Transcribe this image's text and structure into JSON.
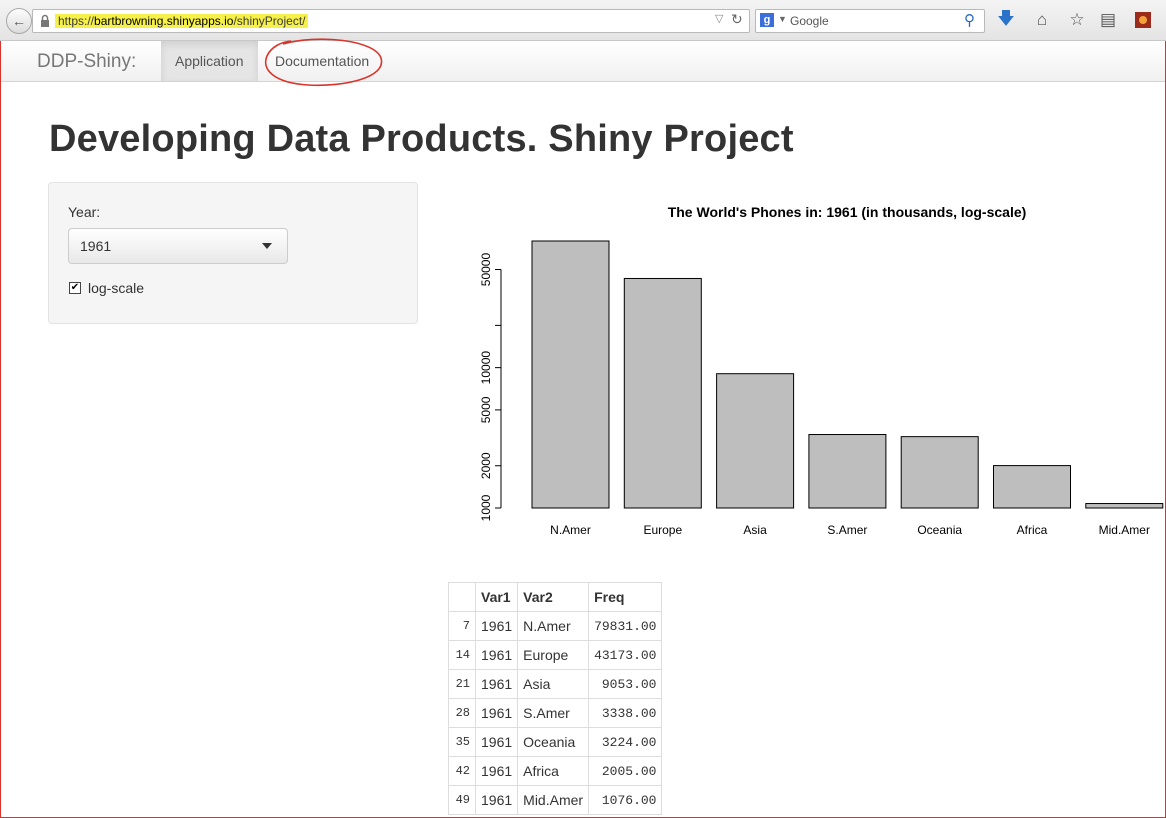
{
  "browser": {
    "url": "https://bartbrowning.shinyapps.io/shinyProject/",
    "url_prefix": "https://",
    "url_host": "bartbrowning.shinyapps.io",
    "url_path": "/shinyProject/",
    "search_placeholder": "Google",
    "icons": [
      "back-arrow-icon",
      "lock-icon",
      "reload-icon",
      "google-icon",
      "search-icon",
      "download-icon",
      "home-icon",
      "bookmark-star-icon",
      "reading-list-icon",
      "addon-icon"
    ]
  },
  "navbar": {
    "brand": "DDP-Shiny:",
    "tabs": [
      {
        "label": "Application",
        "active": true
      },
      {
        "label": "Documentation",
        "active": false
      }
    ]
  },
  "page": {
    "title": "Developing Data Products. Shiny Project"
  },
  "sidebar": {
    "year_label": "Year:",
    "year_value": "1961",
    "log_checkbox_label": "log-scale",
    "log_checked": true
  },
  "chart_data": {
    "type": "bar",
    "title": "The World's Phones in: 1961 (in thousands, log-scale)",
    "categories": [
      "N.Amer",
      "Europe",
      "Asia",
      "S.Amer",
      "Oceania",
      "Africa",
      "Mid.Amer"
    ],
    "values": [
      79831,
      43173,
      9053,
      3338,
      3224,
      2005,
      1076
    ],
    "y_scale": "log",
    "y_ticks": [
      1000,
      2000,
      5000,
      10000,
      20000,
      50000
    ],
    "y_tick_labels": [
      "1000",
      "2000",
      "5000",
      "10000",
      "",
      "50000"
    ],
    "ylim": [
      1000,
      79831
    ],
    "bar_color": "#bebebe",
    "xlabel": "",
    "ylabel": ""
  },
  "table": {
    "columns": [
      "",
      "Var1",
      "Var2",
      "Freq"
    ],
    "rows": [
      [
        "7",
        "1961",
        "N.Amer",
        "79831.00"
      ],
      [
        "14",
        "1961",
        "Europe",
        "43173.00"
      ],
      [
        "21",
        "1961",
        "Asia",
        "9053.00"
      ],
      [
        "28",
        "1961",
        "S.Amer",
        "3338.00"
      ],
      [
        "35",
        "1961",
        "Oceania",
        "3224.00"
      ],
      [
        "42",
        "1961",
        "Africa",
        "2005.00"
      ],
      [
        "49",
        "1961",
        "Mid.Amer",
        "1076.00"
      ]
    ]
  },
  "colors": {
    "highlight": "#f6f04a",
    "annotation_red": "#d9342b"
  }
}
